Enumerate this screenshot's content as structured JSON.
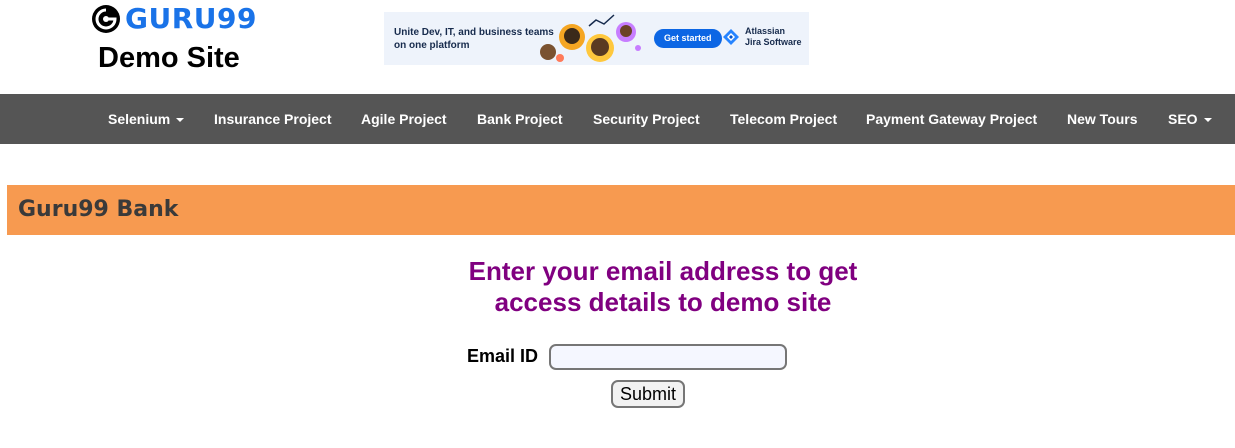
{
  "header": {
    "logo_text": "GURU99",
    "site_title": "Demo Site"
  },
  "ad": {
    "headline": "Unite Dev, IT, and business teams on one platform",
    "cta": "Get started",
    "brand_line1": "Atlassian",
    "brand_line2": "Jira Software"
  },
  "nav": {
    "items": [
      {
        "label": "Selenium",
        "dropdown": true
      },
      {
        "label": "Insurance Project",
        "dropdown": false
      },
      {
        "label": "Agile Project",
        "dropdown": false
      },
      {
        "label": "Bank Project",
        "dropdown": false
      },
      {
        "label": "Security Project",
        "dropdown": false
      },
      {
        "label": "Telecom Project",
        "dropdown": false
      },
      {
        "label": "Payment Gateway Project",
        "dropdown": false
      },
      {
        "label": "New Tours",
        "dropdown": false
      },
      {
        "label": "SEO",
        "dropdown": true
      }
    ]
  },
  "bank_bar": {
    "title": "Guru99 Bank"
  },
  "form": {
    "heading_line1": "Enter your email address to get",
    "heading_line2": "access details to demo site",
    "email_label": "Email ID",
    "email_value": "",
    "submit_label": "Submit"
  },
  "colors": {
    "logo_blue": "#1a73e8",
    "navbar_bg": "#555555",
    "bank_bar_bg": "#f79a50",
    "heading_purple": "#800080"
  }
}
